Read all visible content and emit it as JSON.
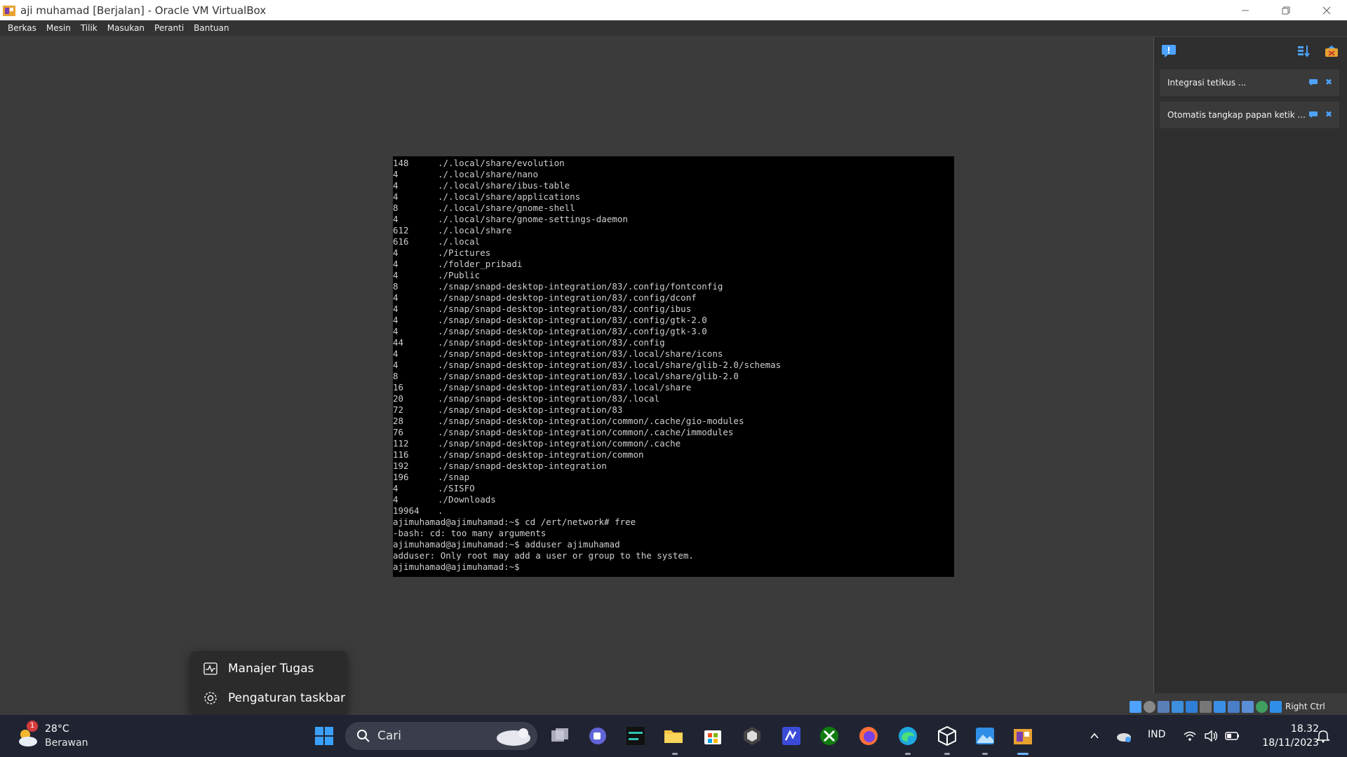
{
  "window": {
    "title": "aji muhamad  [Berjalan] - Oracle VM VirtualBox",
    "controls": [
      "minimize-icon",
      "restore-icon",
      "close-icon"
    ]
  },
  "menubar": {
    "items": [
      "Berkas",
      "Mesin",
      "Tilik",
      "Masukan",
      "Peranti",
      "Bantuan"
    ]
  },
  "terminal": {
    "du_lines": [
      {
        "size": "148",
        "path": "./.local/share/evolution"
      },
      {
        "size": "4",
        "path": "./.local/share/nano"
      },
      {
        "size": "4",
        "path": "./.local/share/ibus-table"
      },
      {
        "size": "4",
        "path": "./.local/share/applications"
      },
      {
        "size": "8",
        "path": "./.local/share/gnome-shell"
      },
      {
        "size": "4",
        "path": "./.local/share/gnome-settings-daemon"
      },
      {
        "size": "612",
        "path": "./.local/share"
      },
      {
        "size": "616",
        "path": "./.local"
      },
      {
        "size": "4",
        "path": "./Pictures"
      },
      {
        "size": "4",
        "path": "./folder_pribadi"
      },
      {
        "size": "4",
        "path": "./Public"
      },
      {
        "size": "8",
        "path": "./snap/snapd-desktop-integration/83/.config/fontconfig"
      },
      {
        "size": "4",
        "path": "./snap/snapd-desktop-integration/83/.config/dconf"
      },
      {
        "size": "4",
        "path": "./snap/snapd-desktop-integration/83/.config/ibus"
      },
      {
        "size": "4",
        "path": "./snap/snapd-desktop-integration/83/.config/gtk-2.0"
      },
      {
        "size": "4",
        "path": "./snap/snapd-desktop-integration/83/.config/gtk-3.0"
      },
      {
        "size": "44",
        "path": "./snap/snapd-desktop-integration/83/.config"
      },
      {
        "size": "4",
        "path": "./snap/snapd-desktop-integration/83/.local/share/icons"
      },
      {
        "size": "4",
        "path": "./snap/snapd-desktop-integration/83/.local/share/glib-2.0/schemas"
      },
      {
        "size": "8",
        "path": "./snap/snapd-desktop-integration/83/.local/share/glib-2.0"
      },
      {
        "size": "16",
        "path": "./snap/snapd-desktop-integration/83/.local/share"
      },
      {
        "size": "20",
        "path": "./snap/snapd-desktop-integration/83/.local"
      },
      {
        "size": "72",
        "path": "./snap/snapd-desktop-integration/83"
      },
      {
        "size": "28",
        "path": "./snap/snapd-desktop-integration/common/.cache/gio-modules"
      },
      {
        "size": "76",
        "path": "./snap/snapd-desktop-integration/common/.cache/immodules"
      },
      {
        "size": "112",
        "path": "./snap/snapd-desktop-integration/common/.cache"
      },
      {
        "size": "116",
        "path": "./snap/snapd-desktop-integration/common"
      },
      {
        "size": "192",
        "path": "./snap/snapd-desktop-integration"
      },
      {
        "size": "196",
        "path": "./snap"
      },
      {
        "size": "4",
        "path": "./SISFO"
      },
      {
        "size": "4",
        "path": "./Downloads"
      },
      {
        "size": "19964",
        "path": "."
      }
    ],
    "tail_lines": [
      "ajimuhamad@ajimuhamad:~$ cd /ert/network# free",
      "-bash: cd: too many arguments",
      "ajimuhamad@ajimuhamad:~$ adduser ajimuhamad",
      "adduser: Only root may add a user or group to the system.",
      "ajimuhamad@ajimuhamad:~$"
    ]
  },
  "side_panel": {
    "top_icons": [
      "chat-icon",
      "sort-icon",
      "erase-icon"
    ],
    "notifications": [
      {
        "text": "Integrasi tetikus ..."
      },
      {
        "text": "Otomatis tangkap papan ketik ..."
      }
    ]
  },
  "statusbar": {
    "host_key_label": "Right Ctrl"
  },
  "context_menu": {
    "items": [
      {
        "icon": "task-manager-icon",
        "label": "Manajer Tugas"
      },
      {
        "icon": "gear-icon",
        "label": "Pengaturan taskbar"
      }
    ]
  },
  "taskbar": {
    "weather": {
      "temp": "28°C",
      "desc": "Berawan",
      "badge": "1"
    },
    "search_label": "Cari",
    "language": "IND",
    "time": "18.32",
    "date": "18/11/2023",
    "accent": "#0078d4"
  }
}
